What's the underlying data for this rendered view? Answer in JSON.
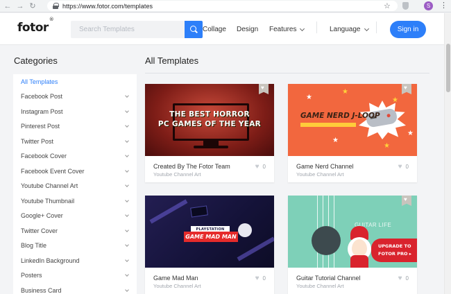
{
  "browser": {
    "url": "https://www.fotor.com/templates",
    "profile_initial": "S"
  },
  "header": {
    "logo": "fotor",
    "search_placeholder": "Search Templates",
    "nav": {
      "collage": "Collage",
      "design": "Design",
      "features": "Features",
      "language": "Language"
    },
    "signin_label": "Sign in"
  },
  "sidebar": {
    "title": "Categories",
    "items": [
      {
        "label": "All Templates",
        "active": true
      },
      {
        "label": "Facebook Post"
      },
      {
        "label": "Instagram Post"
      },
      {
        "label": "Pinterest Post"
      },
      {
        "label": "Twitter Post"
      },
      {
        "label": "Facebook Cover"
      },
      {
        "label": "Facebook Event Cover"
      },
      {
        "label": "Youtube Channel Art"
      },
      {
        "label": "Youtube Thumbnail"
      },
      {
        "label": "Google+ Cover"
      },
      {
        "label": "Twitter Cover"
      },
      {
        "label": "Blog Title"
      },
      {
        "label": "LinkedIn Background"
      },
      {
        "label": "Posters"
      },
      {
        "label": "Business Card"
      }
    ]
  },
  "main": {
    "title": "All Templates",
    "cards": [
      {
        "title": "Created By The Fotor Team",
        "category": "Youtube Channel Art",
        "likes": "0",
        "thumb_text": [
          "THE BEST HORROR",
          "PC GAMES OF THE YEAR"
        ]
      },
      {
        "title": "Game Nerd Channel",
        "category": "Youtube Channel Art",
        "likes": "0",
        "thumb_text": [
          "GAME NERD J-LOOP"
        ]
      },
      {
        "title": "Game Mad Man",
        "category": "Youtube Channel Art",
        "likes": "0",
        "thumb_text": [
          "PLAYSTATION",
          "GAME MAD MAN"
        ]
      },
      {
        "title": "Guitar Tutorial Channel",
        "category": "Youtube Channel Art",
        "likes": "0",
        "thumb_text": [
          "GUITAR LIFE"
        ],
        "promo": [
          "UPGRADE TO",
          "FOTOR PRO ▸"
        ]
      }
    ]
  },
  "colors": {
    "accent": "#2d7ff9",
    "active_category": "#2d7ff9",
    "promo_red": "#d9232d"
  }
}
